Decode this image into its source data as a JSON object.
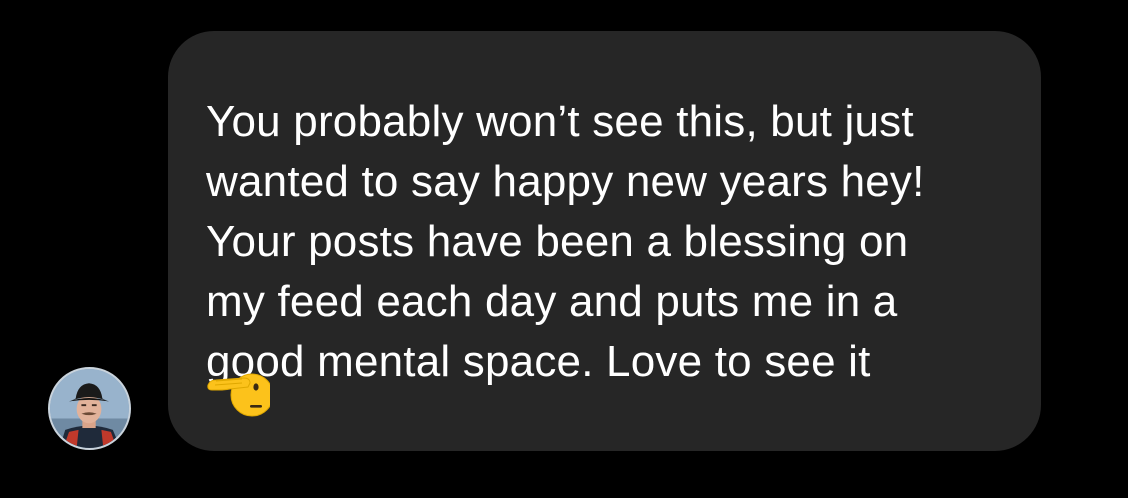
{
  "message": {
    "lines": [
      "You probably won’t see this, but just",
      "wanted to say happy new years hey!",
      "Your posts have been a blessing on",
      "my feed each day and puts me in a",
      "good mental space. Love to see it"
    ],
    "emoji": "saluting-face-emoji"
  },
  "sender": {
    "avatar": "profile-photo"
  },
  "colors": {
    "background": "#000000",
    "bubble": "#262626",
    "text": "#ffffff",
    "avatar_ring": "#c9d3dc"
  }
}
